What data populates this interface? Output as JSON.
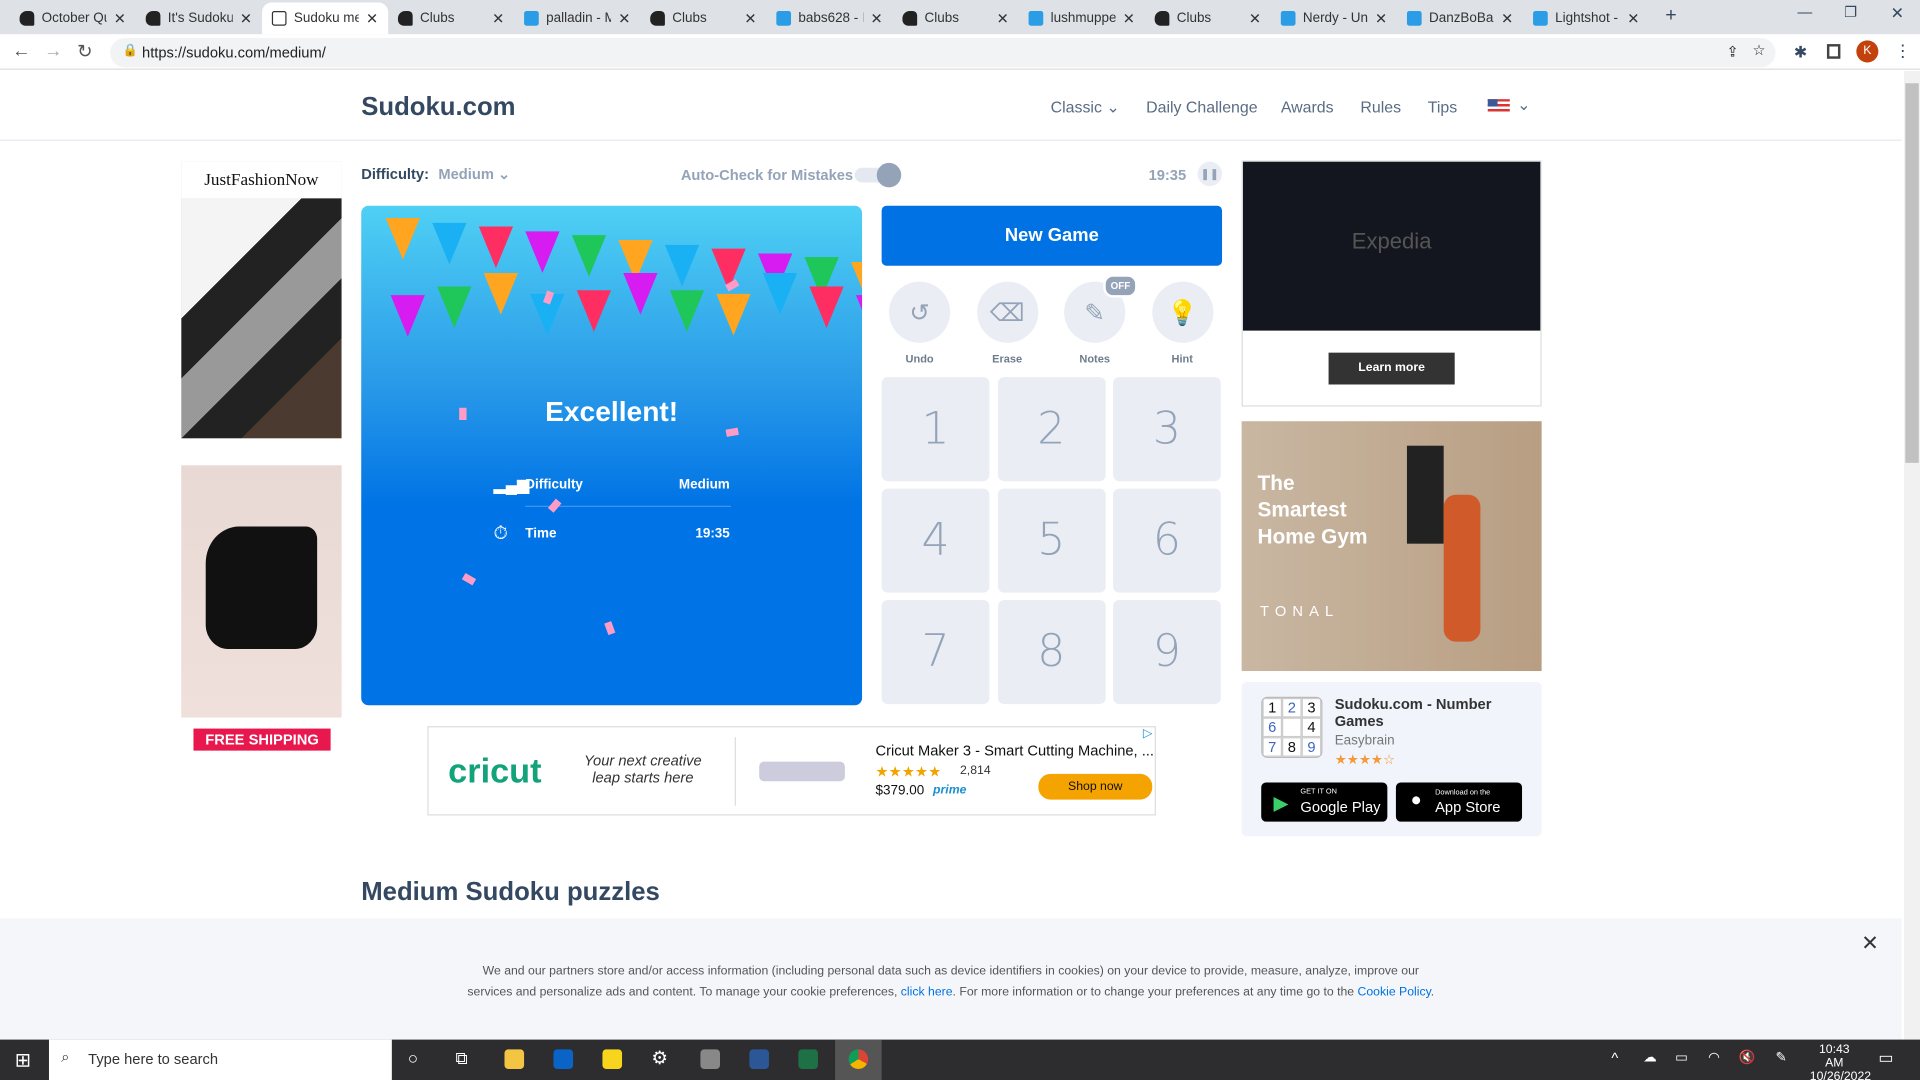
{
  "browser": {
    "tabs": [
      "October Qu",
      "It's Sudoku",
      "Sudoku me",
      "Clubs",
      "palladin - M",
      "Clubs",
      "babs628 - B",
      "Clubs",
      "lushmuppet",
      "Clubs",
      "Nerdy - Unt",
      "DanzBoBan",
      "Lightshot -"
    ],
    "active_tab": 2,
    "url": "https://sudoku.com/medium/",
    "profile": "K"
  },
  "site": {
    "logo": "Sudoku.com",
    "nav": [
      "Classic",
      "Daily Challenge",
      "Awards",
      "Rules",
      "Tips"
    ]
  },
  "game": {
    "difficulty_label": "Difficulty:",
    "difficulty_value": "Medium",
    "autocheck_label": "Auto-Check for Mistakes",
    "autocheck_on": false,
    "timer": "19:35",
    "result": {
      "title": "Excellent!",
      "difficulty_label": "Difficulty",
      "difficulty_value": "Medium",
      "time_label": "Time",
      "time_value": "19:35"
    },
    "new_game": "New Game",
    "tools": [
      {
        "label": "Undo",
        "icon": "undo-icon"
      },
      {
        "label": "Erase",
        "icon": "eraser-icon"
      },
      {
        "label": "Notes",
        "icon": "pencil-icon",
        "badge": "OFF"
      },
      {
        "label": "Hint",
        "icon": "lightbulb-icon"
      }
    ],
    "numbers": [
      "1",
      "2",
      "3",
      "4",
      "5",
      "6",
      "7",
      "8",
      "9"
    ]
  },
  "ads": {
    "left_brand": "JustFashionNow",
    "left_cta": "FREE SHIPPING",
    "right_top_cta": "Learn more",
    "right_top_brand": "Expedia",
    "right_mid_text": "The Smartest Home Gym",
    "right_mid_brand": "TONAL",
    "cricut": {
      "brand": "cricut",
      "tagline": "Your next creative leap starts here",
      "product": "Cricut Maker 3 - Smart Cutting Machine, ...",
      "reviews": "2,814",
      "price": "$379.00",
      "prime": "prime",
      "cta": "Shop now"
    }
  },
  "app_promo": {
    "title": "Sudoku.com - Number Games",
    "developer": "Easybrain",
    "rating": 4.5,
    "grid": [
      "1",
      "2",
      "3",
      "6",
      "",
      "4",
      "7",
      "8",
      "9"
    ],
    "google": {
      "small": "GET IT ON",
      "big": "Google Play"
    },
    "apple": {
      "small": "Download on the",
      "big": "App Store"
    }
  },
  "section_title": "Medium Sudoku puzzles",
  "cookie": {
    "line1": "We and our partners store and/or access information (including personal data such as device identifiers in cookies) on your device to provide, measure, analyze, improve our",
    "line2a": "services and personalize ads and content. To manage your cookie preferences,",
    "link1": "click here",
    "line2b": ". For more information or to change your preferences at any time go to the",
    "link2": "Cookie Policy",
    "end": "."
  },
  "taskbar": {
    "search_placeholder": "Type here to search",
    "time": "10:43 AM",
    "date": "10/26/2022"
  }
}
